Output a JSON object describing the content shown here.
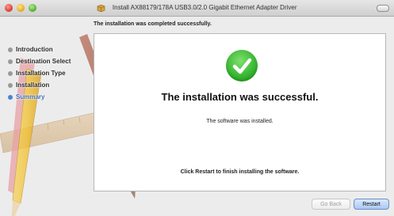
{
  "window": {
    "title": "Install AX88179/178A USB3.0/2.0 Gigabit Ethernet Adapter Driver",
    "title_icon": "package-icon"
  },
  "header": {
    "subtitle": "The installation was completed successfully."
  },
  "sidebar": {
    "items": [
      {
        "label": "Introduction",
        "active": false
      },
      {
        "label": "Destination Select",
        "active": false
      },
      {
        "label": "Installation Type",
        "active": false
      },
      {
        "label": "Installation",
        "active": false
      },
      {
        "label": "Summary",
        "active": true
      }
    ]
  },
  "main": {
    "status_icon": "checkmark-icon",
    "heading": "The installation was successful.",
    "message": "The software was installed.",
    "note": "Click Restart to finish installing the software."
  },
  "buttons": {
    "back_label": "Go Back",
    "restart_label": "Restart"
  },
  "colors": {
    "accent": "#4a82d6",
    "success_green": "#2fb02a"
  }
}
